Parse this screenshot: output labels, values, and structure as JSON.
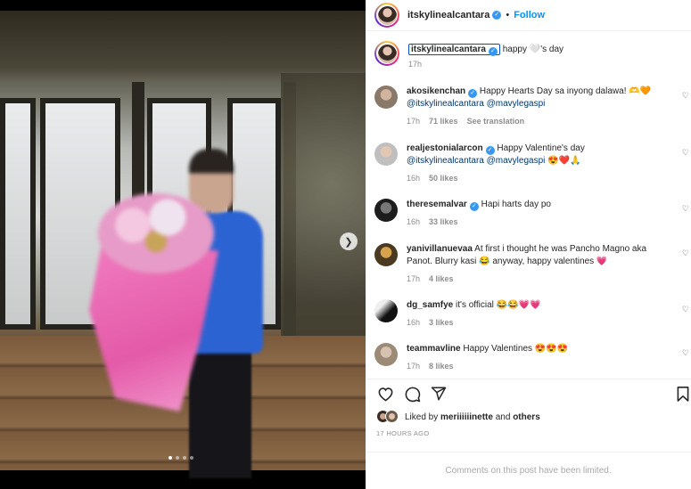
{
  "post": {
    "username": "itskylinealcantara",
    "follow_label": "Follow",
    "caption_text": "happy 🤍's day",
    "caption_time": "17h",
    "image_index": 1,
    "image_count": 4
  },
  "comments": [
    {
      "username": "akosikenchan",
      "verified": true,
      "text": " Happy Hearts Day sa inyong dalawa! 🫶🧡",
      "mentions": "@itskylinealcantara @mavylegaspi",
      "time": "17h",
      "likes": "71 likes",
      "extra": "See translation"
    },
    {
      "username": "realjestonialarcon",
      "verified": true,
      "text": " Happy Valentine's day",
      "mentions": "@itskylinealcantara @mavylegaspi 😍❤️🙏",
      "time": "16h",
      "likes": "50 likes",
      "extra": ""
    },
    {
      "username": "theresemalvar",
      "verified": true,
      "text": " Hapi harts day po",
      "mentions": "",
      "time": "16h",
      "likes": "33 likes",
      "extra": ""
    },
    {
      "username": "yanivillanuevaa",
      "verified": false,
      "text": " At first i thought he was Pancho Magno aka Panot. Blurry kasi 😂 anyway, happy valentines 💗",
      "mentions": "",
      "time": "17h",
      "likes": "4 likes",
      "extra": ""
    },
    {
      "username": "dg_samfye",
      "verified": false,
      "text": " it's official 😂😂💗💗",
      "mentions": "",
      "time": "16h",
      "likes": "3 likes",
      "extra": ""
    },
    {
      "username": "teammavline",
      "verified": false,
      "text": " Happy Valentines 😍😍😍",
      "mentions": "",
      "time": "17h",
      "likes": "8 likes",
      "extra": ""
    }
  ],
  "liked_by": {
    "prefix": "Liked by ",
    "user": "meriiiiiinette",
    "middle": " and ",
    "others": "others"
  },
  "timestamp": "17 HOURS AGO",
  "limited_notice": "Comments on this post have been limited.",
  "icons": {
    "like": "heart-icon",
    "comment": "comment-icon",
    "share": "share-icon",
    "save": "bookmark-icon",
    "next": "chevron-right-icon"
  },
  "colors": {
    "accent": "#0095f6",
    "verified": "#3897f0",
    "mention": "#00376b",
    "muted": "#8e8e8e"
  }
}
